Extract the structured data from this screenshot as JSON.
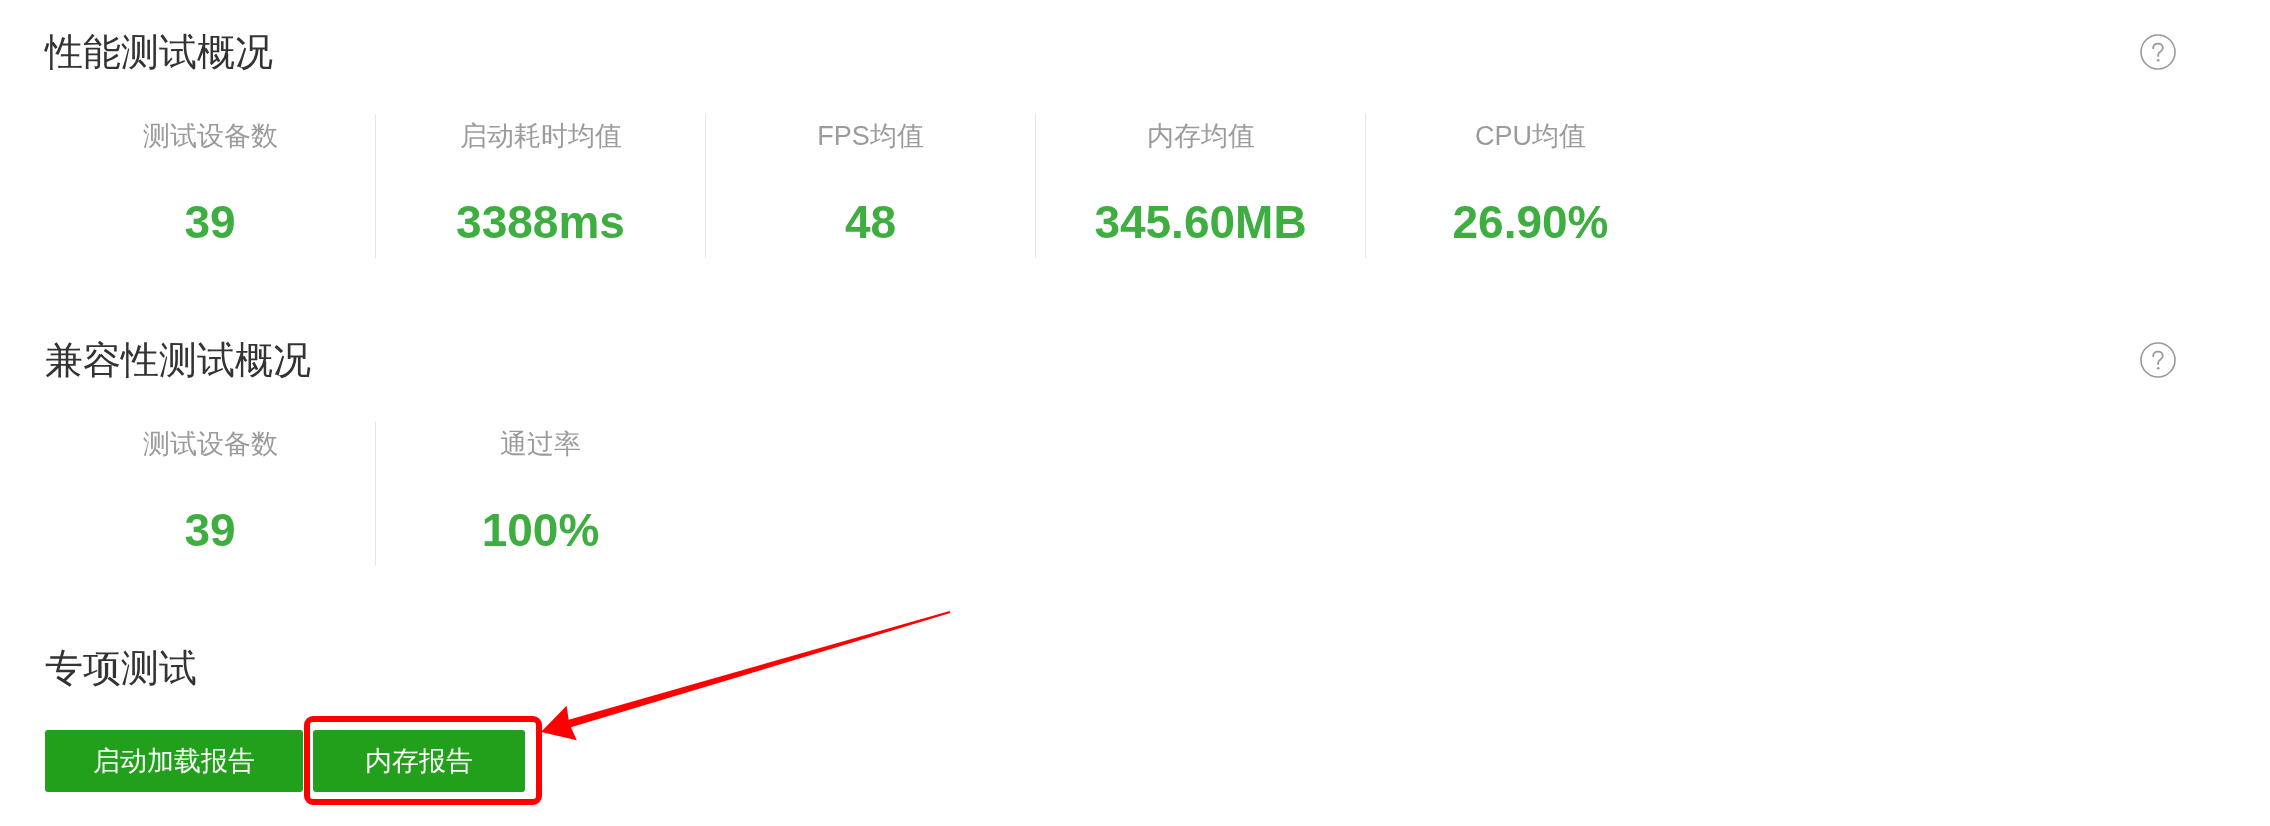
{
  "sections": [
    {
      "kind": "stats",
      "title": "性能测试概况",
      "help_icon": true,
      "stats": [
        {
          "label": "测试设备数",
          "value": "39"
        },
        {
          "label": "启动耗时均值",
          "value": "3388ms"
        },
        {
          "label": "FPS均值",
          "value": "48"
        },
        {
          "label": "内存均值",
          "value": "345.60MB"
        },
        {
          "label": "CPU均值",
          "value": "26.90%"
        }
      ]
    },
    {
      "kind": "stats",
      "title": "兼容性测试概况",
      "help_icon": true,
      "stats": [
        {
          "label": "测试设备数",
          "value": "39"
        },
        {
          "label": "通过率",
          "value": "100%"
        }
      ]
    },
    {
      "kind": "buttons",
      "title": "专项测试",
      "help_icon": false,
      "buttons": [
        {
          "label": "启动加载报告",
          "highlighted": false
        },
        {
          "label": "内存报告",
          "highlighted": true
        }
      ]
    }
  ]
}
